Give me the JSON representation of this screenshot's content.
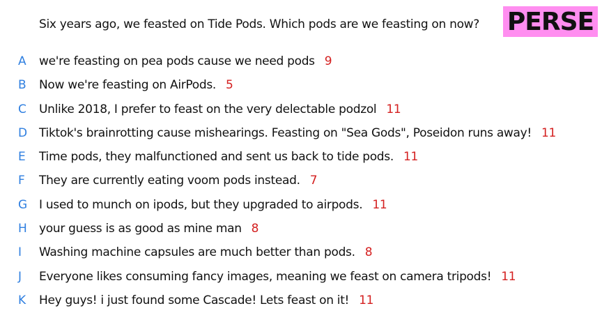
{
  "question": "Six years ago, we feasted on Tide Pods. Which pods are we feasting on now?",
  "badge": "PERSE",
  "answers": [
    {
      "letter": "A",
      "text": "we're feasting on pea pods cause we need pods",
      "score": "9"
    },
    {
      "letter": "B",
      "text": "Now we're feasting on AirPods.",
      "score": "5"
    },
    {
      "letter": "C",
      "text": "Unlike 2018, I prefer to feast on the very delectable podzol",
      "score": "11"
    },
    {
      "letter": "D",
      "text": "Tiktok's brainrotting cause mishearings. Feasting on \"Sea Gods\", Poseidon runs away!",
      "score": "11"
    },
    {
      "letter": "E",
      "text": "Time pods, they malfunctioned and sent us back to tide pods.",
      "score": "11"
    },
    {
      "letter": "F",
      "text": "They are currently eating voom pods instead.",
      "score": "7"
    },
    {
      "letter": "G",
      "text": "I used to munch on ipods, but they upgraded to airpods.",
      "score": "11"
    },
    {
      "letter": "H",
      "text": "your guess is as good as mine man",
      "score": "8"
    },
    {
      "letter": "I",
      "text": "Washing machine capsules are much better than pods.",
      "score": "8"
    },
    {
      "letter": "J",
      "text": "Everyone likes consuming fancy images, meaning we feast on camera tripods!",
      "score": "11"
    },
    {
      "letter": "K",
      "text": "Hey guys! i just found some Cascade! Lets feast on it!",
      "score": "11"
    }
  ],
  "colors": {
    "letter": "#2f7fe0",
    "score": "#d42020",
    "badge_bg": "#ff8ef0"
  }
}
